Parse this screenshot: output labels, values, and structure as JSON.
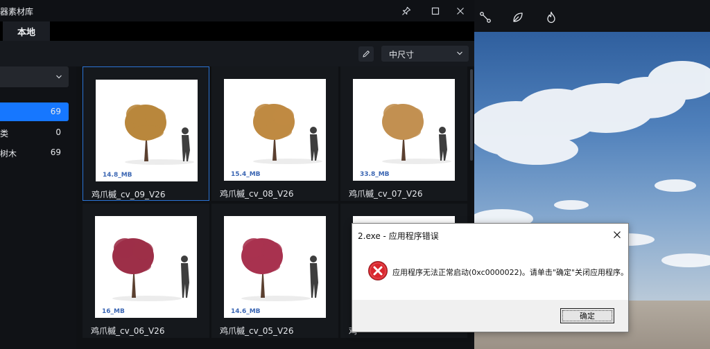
{
  "window": {
    "title": "器素材库",
    "tab_label": "本地",
    "size_select": "中尺寸",
    "sidebar_items": [
      {
        "label": "",
        "count": "69",
        "active": true
      },
      {
        "label": "类",
        "count": "0",
        "active": false
      },
      {
        "label": "树木",
        "count": "69",
        "active": false
      }
    ],
    "assets": [
      {
        "name": "鸡爪槭_cv_09_V26",
        "size": "14.8_MB",
        "foliage": "#b9873c"
      },
      {
        "name": "鸡爪槭_cv_08_V26",
        "size": "15.4_MB",
        "foliage": "#bf8a42"
      },
      {
        "name": "鸡爪槭_cv_07_V26",
        "size": "33.8_MB",
        "foliage": "#c29051"
      },
      {
        "name": "鸡爪槭_cv_06_V26",
        "size": "16_MB",
        "foliage": "#9d2f48"
      },
      {
        "name": "鸡爪槭_cv_05_V26",
        "size": "14.6_MB",
        "foliage": "#a8324f"
      },
      {
        "name": "鸡",
        "size": "",
        "foliage": "#ffffff"
      }
    ]
  },
  "dialog": {
    "title": "2.exe - 应用程序错误",
    "message": "应用程序无法正常启动(0xc0000022)。请单击\"确定\"关闭应用程序。",
    "ok_label": "确定"
  },
  "colors": {
    "accent": "#1677ff",
    "selection_border": "#2b74d6",
    "error_red": "#d9272e"
  },
  "icons": {
    "title_bar": [
      "pin-icon",
      "maximize-icon",
      "close-icon"
    ],
    "toolbar": [
      "pencil-icon",
      "chevron-down-icon"
    ],
    "scene_toolbar": [
      "node-link-icon",
      "leaf-icon",
      "flame-icon"
    ],
    "dialog": [
      "error-icon",
      "close-icon"
    ]
  }
}
